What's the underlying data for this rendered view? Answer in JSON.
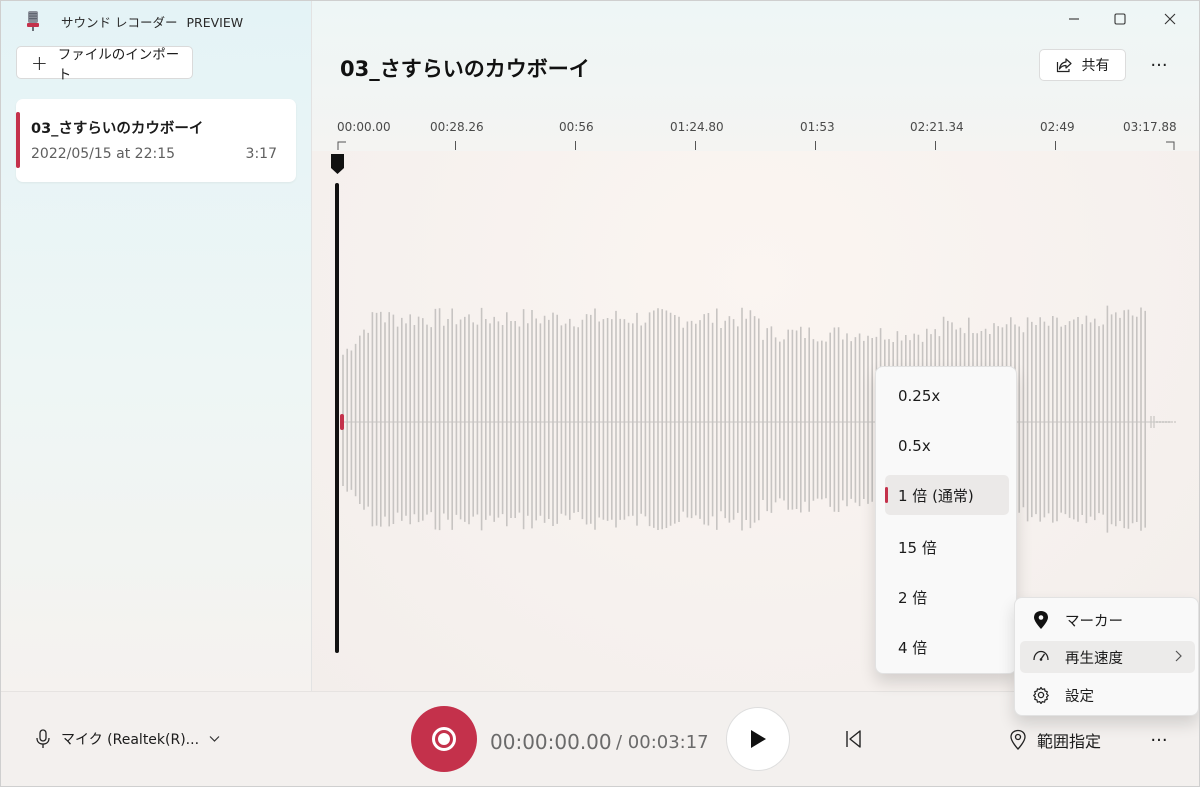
{
  "app": {
    "title": "サウンド レコーダー",
    "badge": "PREVIEW",
    "accent_color": "#c4314b"
  },
  "window_controls": {
    "minimize_icon": "minimize-icon",
    "maximize_icon": "maximize-icon",
    "close_icon": "close-icon"
  },
  "sidebar": {
    "import_label": "ファイルのインポート",
    "recordings": [
      {
        "name": "03_さすらいのカウボーイ",
        "date": "2022/05/15 at 22:15",
        "duration": "3:17"
      }
    ]
  },
  "main": {
    "title": "03_さすらいのカウボーイ",
    "share_label": "共有",
    "more_label": "···"
  },
  "timeline": {
    "ticks": [
      "00:00.00",
      "00:28.26",
      "00:56",
      "01:24.80",
      "01:53",
      "02:21.34",
      "02:49",
      "03:17.88"
    ]
  },
  "player": {
    "mic_label": "マイク (Realtek(R)...",
    "current_time": "00:00:00.00",
    "total_time": "/ 00:03:17",
    "range_label": "範囲指定",
    "more_label": "···"
  },
  "context_menu": {
    "items": [
      {
        "label": "マーカー",
        "icon": "marker-icon"
      },
      {
        "label": "再生速度",
        "icon": "speed-icon",
        "submenu": true
      },
      {
        "label": "設定",
        "icon": "gear-icon"
      }
    ]
  },
  "speed_menu": {
    "options": [
      "0.25x",
      "0.5x",
      "1 倍 (通常)",
      "15 倍",
      "2 倍",
      "4 倍"
    ],
    "selected_index": 2
  }
}
